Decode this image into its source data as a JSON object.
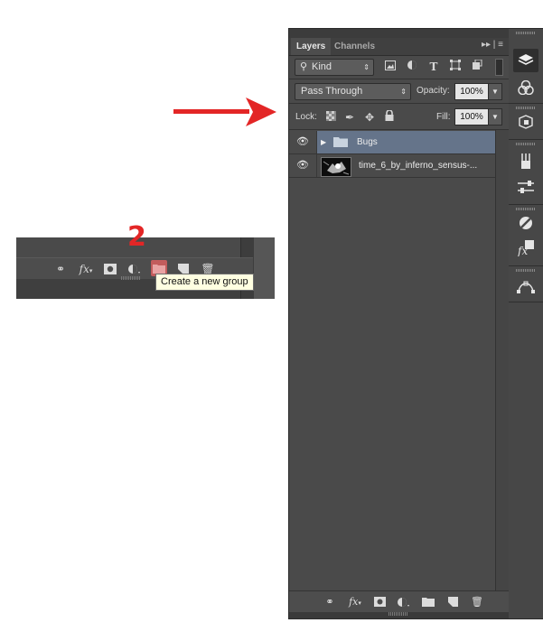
{
  "annotation": {
    "step_number": "2",
    "tooltip": "Create a new group"
  },
  "inset_toolbar": {
    "icons": [
      "link-icon",
      "fx-icon",
      "mask-icon",
      "adjustment-icon",
      "new-group-icon",
      "new-layer-icon",
      "trash-icon"
    ],
    "fx_label": "fx"
  },
  "panel": {
    "tabs": [
      "Layers",
      "Channels"
    ],
    "filter": {
      "label": "Kind"
    },
    "blend_mode": "Pass Through",
    "opacity_label": "Opacity:",
    "opacity_value": "100%",
    "lock_label": "Lock:",
    "fill_label": "Fill:",
    "fill_value": "100%",
    "filter_icons": [
      "image-icon",
      "adjustment-icon",
      "type-icon",
      "shape-icon",
      "smart-object-icon"
    ],
    "layers": [
      {
        "name": "Bugs",
        "type": "group",
        "visible": true,
        "selected": true
      },
      {
        "name": "time_6_by_inferno_sensus-...",
        "type": "image",
        "visible": true,
        "selected": false
      }
    ],
    "bottom_icons": [
      "link-icon",
      "fx-icon",
      "mask-icon",
      "adjustment-icon",
      "new-group-icon",
      "new-layer-icon",
      "trash-icon"
    ],
    "fx_label": "fx"
  },
  "dock": {
    "buttons": [
      "layers-icon",
      "channels-icon",
      "3d-icon",
      "brushes-icon",
      "adjust-icon",
      "adjustments-icon",
      "styles-icon",
      "paths-icon"
    ]
  },
  "colors": {
    "accent_red": "#e32626",
    "panel_bg": "#4a4a4a",
    "selected_row": "#65748a",
    "tooltip_bg": "#ffffe1"
  }
}
